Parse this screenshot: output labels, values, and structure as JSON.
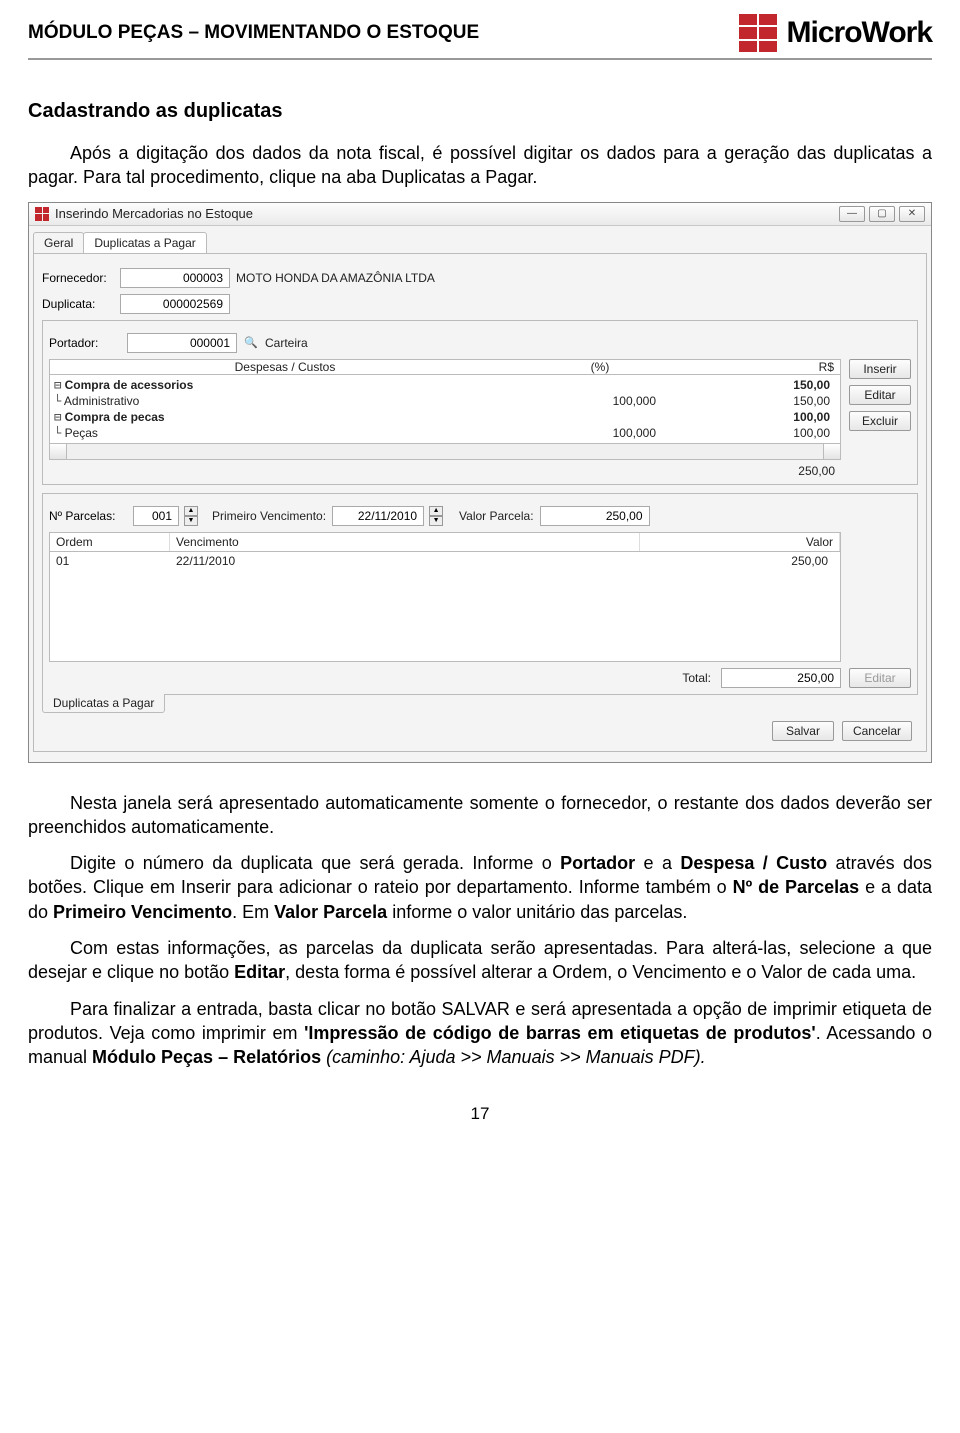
{
  "header": {
    "title": "MÓDULO PEÇAS – MOVIMENTANDO O ESTOQUE",
    "brand": "MicroWork"
  },
  "doc": {
    "h1": "Cadastrando as duplicatas",
    "p1a": "Após a digitação dos dados da nota fiscal, é possível digitar os dados para a geração das duplicatas a pagar. Para tal procedimento, clique na aba Duplicatas a Pagar.",
    "p2": "Nesta janela será apresentado automaticamente somente o fornecedor, o restante dos dados deverão ser preenchidos automaticamente.",
    "p3a": "Digite o número da duplicata que será gerada. Informe o ",
    "p3b": "Portador",
    "p3c": " e a ",
    "p3d": "Despesa / Custo",
    "p3e": " através dos botões. Clique em Inserir para adicionar o rateio por departamento. Informe também o ",
    "p3f": "Nº de Parcelas",
    "p3g": " e a data do ",
    "p3h": "Primeiro Vencimento",
    "p3i": ". Em ",
    "p3j": "Valor Parcela",
    "p3k": " informe o valor unitário das parcelas.",
    "p4a": "Com estas informações, as parcelas da duplicata serão apresentadas. Para alterá-las, selecione a que desejar e clique no botão ",
    "p4b": "Editar",
    "p4c": ", desta forma é possível alterar a Ordem, o Vencimento e o Valor de cada uma.",
    "p5a": "Para finalizar a entrada, basta clicar no botão SALVAR e será apresentada a opção de imprimir etiqueta de produtos. Veja como imprimir em ",
    "p5b": "'Impressão de código de barras em etiquetas de produtos'",
    "p5c": ". Acessando o manual ",
    "p5d": "Módulo Peças – Relatórios",
    "p5e": " (caminho: Ajuda >> Manuais >> Manuais PDF).",
    "page_number": "17"
  },
  "win": {
    "title": "Inserindo Mercadorias no Estoque",
    "tabs": {
      "geral": "Geral",
      "duplicatas": "Duplicatas a Pagar"
    },
    "fornecedor_label": "Fornecedor:",
    "fornecedor_value": "000003",
    "fornecedor_name": "MOTO HONDA DA AMAZÔNIA LTDA",
    "duplicata_label": "Duplicata:",
    "duplicata_value": "000002569",
    "portador_label": "Portador:",
    "portador_value": "000001",
    "portador_name": "Carteira",
    "cost_headers": {
      "c1": "Despesas / Custos",
      "c2": "(%)",
      "c3": "R$"
    },
    "cost_rows": [
      {
        "glyph": "⊟",
        "label": "Compra de acessorios",
        "pct": "",
        "rs": "150,00",
        "bold": true
      },
      {
        "glyph": "  └",
        "label": "Administrativo",
        "pct": "100,000",
        "rs": "150,00",
        "bold": false
      },
      {
        "glyph": "⊟",
        "label": "Compra de pecas",
        "pct": "",
        "rs": "100,00",
        "bold": true
      },
      {
        "glyph": "  └",
        "label": "Peças",
        "pct": "100,000",
        "rs": "100,00",
        "bold": false
      }
    ],
    "cost_total": "250,00",
    "btn_inserir": "Inserir",
    "btn_editar": "Editar",
    "btn_excluir": "Excluir",
    "nparc_label": "Nº Parcelas:",
    "nparc_value": "001",
    "primeiro_venc_label": "Primeiro Vencimento:",
    "primeiro_venc_value": "22/11/2010",
    "valor_parc_label": "Valor Parcela:",
    "valor_parc_value": "250,00",
    "grid_headers": {
      "ordem": "Ordem",
      "venc": "Vencimento",
      "valor": "Valor"
    },
    "grid_rows": [
      {
        "ordem": "01",
        "venc": "22/11/2010",
        "valor": "250,00"
      }
    ],
    "btn_editar2": "Editar",
    "total_label": "Total:",
    "total_value": "250,00",
    "status_tab": "Duplicatas a Pagar",
    "btn_salvar": "Salvar",
    "btn_cancelar": "Cancelar"
  }
}
